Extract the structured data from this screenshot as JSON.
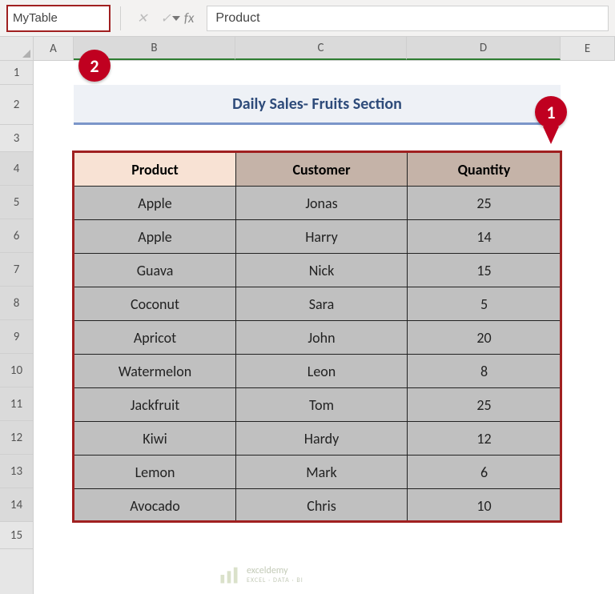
{
  "formula_bar": {
    "name_box_value": "MyTable",
    "formula_value": "Product"
  },
  "columns": {
    "A": "A",
    "B": "B",
    "C": "C",
    "D": "D",
    "E": "E"
  },
  "row_labels": [
    "1",
    "2",
    "3",
    "4",
    "5",
    "6",
    "7",
    "8",
    "9",
    "10",
    "11",
    "12",
    "13",
    "14",
    "15"
  ],
  "title": "Daily Sales- Fruits Section",
  "callouts": {
    "one": "1",
    "two": "2"
  },
  "table": {
    "headers": {
      "product": "Product",
      "customer": "Customer",
      "quantity": "Quantity"
    },
    "rows": [
      {
        "product": "Apple",
        "customer": "Jonas",
        "quantity": "25"
      },
      {
        "product": "Apple",
        "customer": "Harry",
        "quantity": "14"
      },
      {
        "product": "Guava",
        "customer": "Nick",
        "quantity": "15"
      },
      {
        "product": "Coconut",
        "customer": "Sara",
        "quantity": "5"
      },
      {
        "product": "Apricot",
        "customer": "John",
        "quantity": "20"
      },
      {
        "product": "Watermelon",
        "customer": "Leon",
        "quantity": "8"
      },
      {
        "product": "Jackfruit",
        "customer": "Tom",
        "quantity": "25"
      },
      {
        "product": "Kiwi",
        "customer": "Hardy",
        "quantity": "12"
      },
      {
        "product": "Lemon",
        "customer": "Mark",
        "quantity": "6"
      },
      {
        "product": "Avocado",
        "customer": "Chris",
        "quantity": "10"
      }
    ]
  },
  "watermark": {
    "brand": "exceldemy",
    "tagline": "EXCEL · DATA · BI"
  }
}
